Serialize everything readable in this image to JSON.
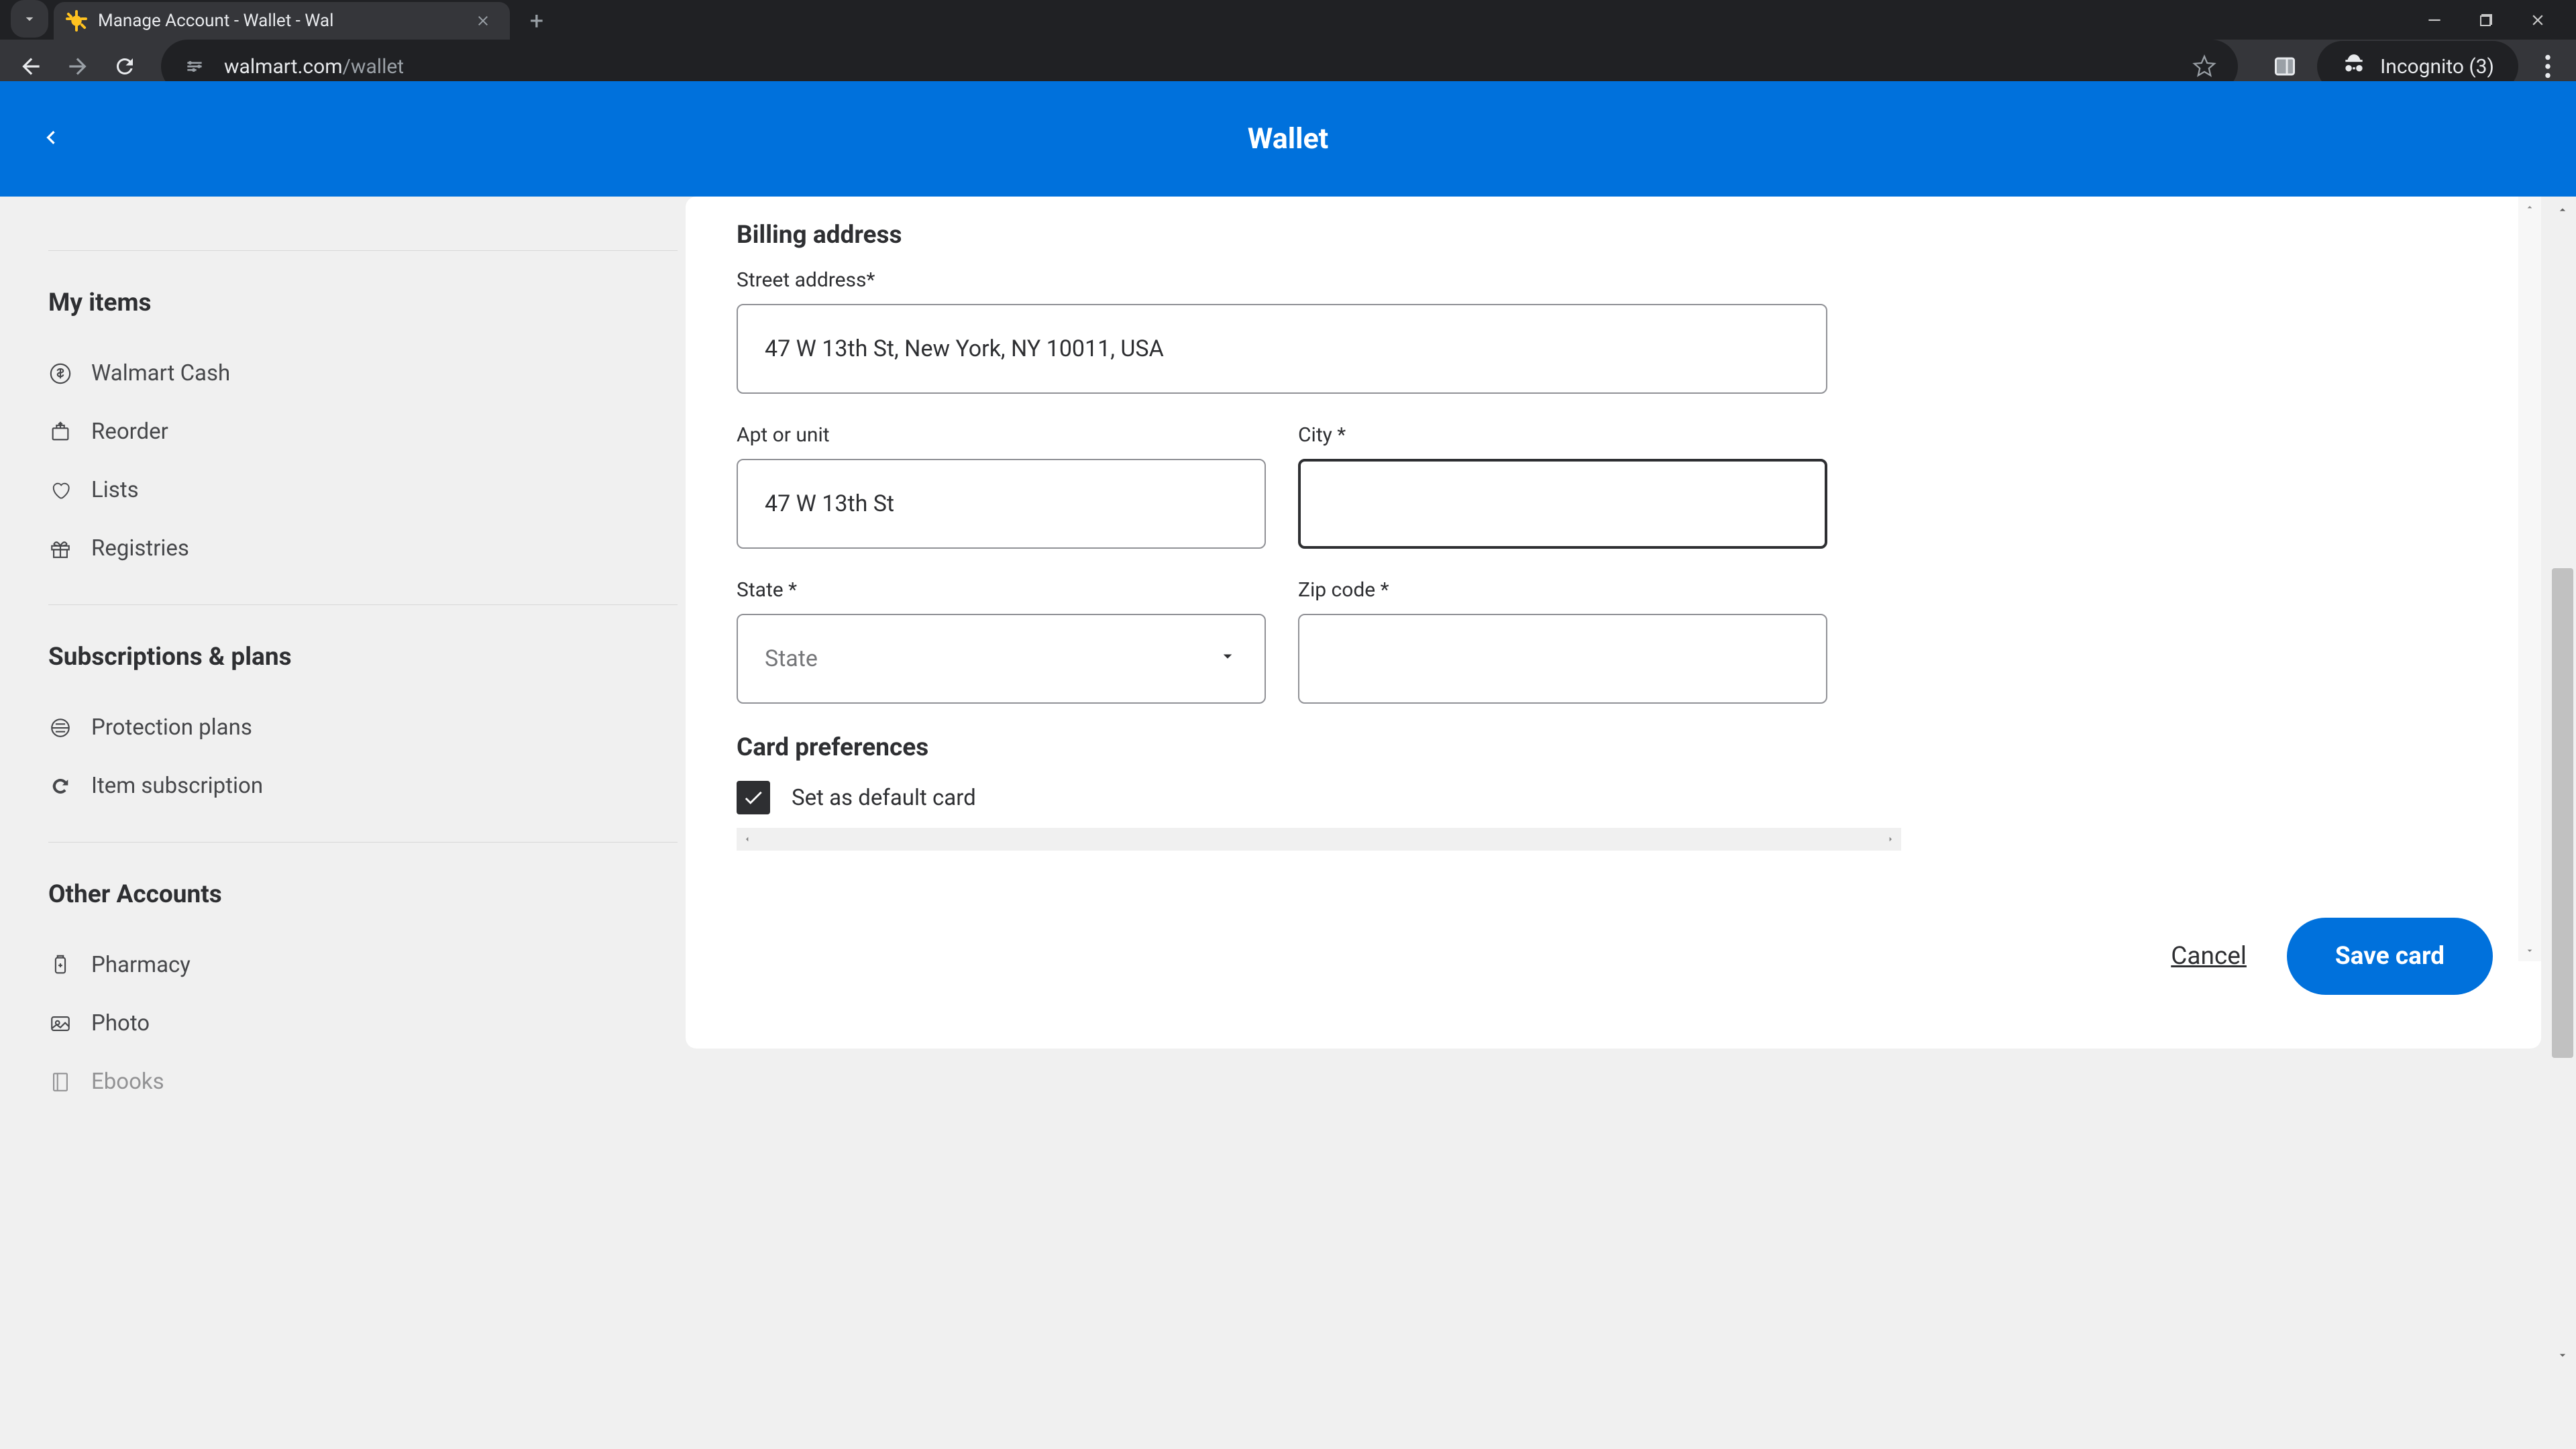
{
  "browser": {
    "tab_title": "Manage Account - Wallet - Wal",
    "url_domain": "walmart.com",
    "url_path": "/wallet",
    "incognito_label": "Incognito (3)"
  },
  "header": {
    "title": "Wallet"
  },
  "sidebar": {
    "sections": [
      {
        "heading": "My items",
        "items": [
          {
            "icon": "cash",
            "label": "Walmart Cash"
          },
          {
            "icon": "reorder",
            "label": "Reorder"
          },
          {
            "icon": "heart",
            "label": "Lists"
          },
          {
            "icon": "gift",
            "label": "Registries"
          }
        ]
      },
      {
        "heading": "Subscriptions & plans",
        "items": [
          {
            "icon": "shield",
            "label": "Protection plans"
          },
          {
            "icon": "refresh",
            "label": "Item subscription"
          }
        ]
      },
      {
        "heading": "Other Accounts",
        "items": [
          {
            "icon": "pharmacy",
            "label": "Pharmacy"
          },
          {
            "icon": "photo",
            "label": "Photo"
          },
          {
            "icon": "ebooks",
            "label": "Ebooks"
          }
        ]
      }
    ]
  },
  "form": {
    "billing_heading": "Billing address",
    "street_label": "Street address*",
    "street_value": "47 W 13th St, New York, NY 10011, USA",
    "apt_label": "Apt or unit",
    "apt_value": "47 W 13th St",
    "city_label": "City *",
    "city_value": "",
    "state_label": "State *",
    "state_placeholder": "State",
    "zip_label": "Zip code *",
    "zip_value": "",
    "prefs_heading": "Card preferences",
    "default_card_label": "Set as default card",
    "default_card_checked": true
  },
  "buttons": {
    "cancel": "Cancel",
    "save": "Save card"
  }
}
